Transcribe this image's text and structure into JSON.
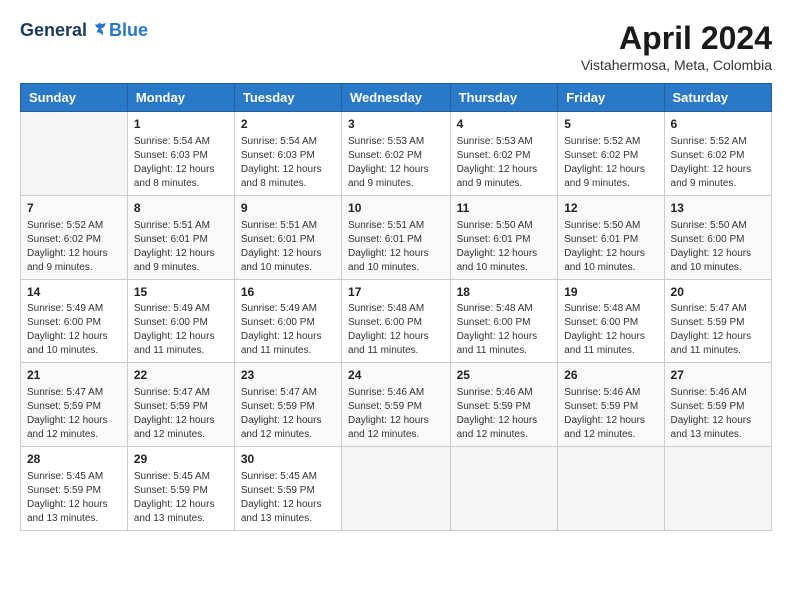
{
  "header": {
    "logo_general": "General",
    "logo_blue": "Blue",
    "month_title": "April 2024",
    "location": "Vistahermosa, Meta, Colombia"
  },
  "calendar": {
    "days_of_week": [
      "Sunday",
      "Monday",
      "Tuesday",
      "Wednesday",
      "Thursday",
      "Friday",
      "Saturday"
    ],
    "weeks": [
      [
        {
          "day": "",
          "sunrise": "",
          "sunset": "",
          "daylight": ""
        },
        {
          "day": "1",
          "sunrise": "Sunrise: 5:54 AM",
          "sunset": "Sunset: 6:03 PM",
          "daylight": "Daylight: 12 hours and 8 minutes."
        },
        {
          "day": "2",
          "sunrise": "Sunrise: 5:54 AM",
          "sunset": "Sunset: 6:03 PM",
          "daylight": "Daylight: 12 hours and 8 minutes."
        },
        {
          "day": "3",
          "sunrise": "Sunrise: 5:53 AM",
          "sunset": "Sunset: 6:02 PM",
          "daylight": "Daylight: 12 hours and 9 minutes."
        },
        {
          "day": "4",
          "sunrise": "Sunrise: 5:53 AM",
          "sunset": "Sunset: 6:02 PM",
          "daylight": "Daylight: 12 hours and 9 minutes."
        },
        {
          "day": "5",
          "sunrise": "Sunrise: 5:52 AM",
          "sunset": "Sunset: 6:02 PM",
          "daylight": "Daylight: 12 hours and 9 minutes."
        },
        {
          "day": "6",
          "sunrise": "Sunrise: 5:52 AM",
          "sunset": "Sunset: 6:02 PM",
          "daylight": "Daylight: 12 hours and 9 minutes."
        }
      ],
      [
        {
          "day": "7",
          "sunrise": "Sunrise: 5:52 AM",
          "sunset": "Sunset: 6:02 PM",
          "daylight": "Daylight: 12 hours and 9 minutes."
        },
        {
          "day": "8",
          "sunrise": "Sunrise: 5:51 AM",
          "sunset": "Sunset: 6:01 PM",
          "daylight": "Daylight: 12 hours and 9 minutes."
        },
        {
          "day": "9",
          "sunrise": "Sunrise: 5:51 AM",
          "sunset": "Sunset: 6:01 PM",
          "daylight": "Daylight: 12 hours and 10 minutes."
        },
        {
          "day": "10",
          "sunrise": "Sunrise: 5:51 AM",
          "sunset": "Sunset: 6:01 PM",
          "daylight": "Daylight: 12 hours and 10 minutes."
        },
        {
          "day": "11",
          "sunrise": "Sunrise: 5:50 AM",
          "sunset": "Sunset: 6:01 PM",
          "daylight": "Daylight: 12 hours and 10 minutes."
        },
        {
          "day": "12",
          "sunrise": "Sunrise: 5:50 AM",
          "sunset": "Sunset: 6:01 PM",
          "daylight": "Daylight: 12 hours and 10 minutes."
        },
        {
          "day": "13",
          "sunrise": "Sunrise: 5:50 AM",
          "sunset": "Sunset: 6:00 PM",
          "daylight": "Daylight: 12 hours and 10 minutes."
        }
      ],
      [
        {
          "day": "14",
          "sunrise": "Sunrise: 5:49 AM",
          "sunset": "Sunset: 6:00 PM",
          "daylight": "Daylight: 12 hours and 10 minutes."
        },
        {
          "day": "15",
          "sunrise": "Sunrise: 5:49 AM",
          "sunset": "Sunset: 6:00 PM",
          "daylight": "Daylight: 12 hours and 11 minutes."
        },
        {
          "day": "16",
          "sunrise": "Sunrise: 5:49 AM",
          "sunset": "Sunset: 6:00 PM",
          "daylight": "Daylight: 12 hours and 11 minutes."
        },
        {
          "day": "17",
          "sunrise": "Sunrise: 5:48 AM",
          "sunset": "Sunset: 6:00 PM",
          "daylight": "Daylight: 12 hours and 11 minutes."
        },
        {
          "day": "18",
          "sunrise": "Sunrise: 5:48 AM",
          "sunset": "Sunset: 6:00 PM",
          "daylight": "Daylight: 12 hours and 11 minutes."
        },
        {
          "day": "19",
          "sunrise": "Sunrise: 5:48 AM",
          "sunset": "Sunset: 6:00 PM",
          "daylight": "Daylight: 12 hours and 11 minutes."
        },
        {
          "day": "20",
          "sunrise": "Sunrise: 5:47 AM",
          "sunset": "Sunset: 5:59 PM",
          "daylight": "Daylight: 12 hours and 11 minutes."
        }
      ],
      [
        {
          "day": "21",
          "sunrise": "Sunrise: 5:47 AM",
          "sunset": "Sunset: 5:59 PM",
          "daylight": "Daylight: 12 hours and 12 minutes."
        },
        {
          "day": "22",
          "sunrise": "Sunrise: 5:47 AM",
          "sunset": "Sunset: 5:59 PM",
          "daylight": "Daylight: 12 hours and 12 minutes."
        },
        {
          "day": "23",
          "sunrise": "Sunrise: 5:47 AM",
          "sunset": "Sunset: 5:59 PM",
          "daylight": "Daylight: 12 hours and 12 minutes."
        },
        {
          "day": "24",
          "sunrise": "Sunrise: 5:46 AM",
          "sunset": "Sunset: 5:59 PM",
          "daylight": "Daylight: 12 hours and 12 minutes."
        },
        {
          "day": "25",
          "sunrise": "Sunrise: 5:46 AM",
          "sunset": "Sunset: 5:59 PM",
          "daylight": "Daylight: 12 hours and 12 minutes."
        },
        {
          "day": "26",
          "sunrise": "Sunrise: 5:46 AM",
          "sunset": "Sunset: 5:59 PM",
          "daylight": "Daylight: 12 hours and 12 minutes."
        },
        {
          "day": "27",
          "sunrise": "Sunrise: 5:46 AM",
          "sunset": "Sunset: 5:59 PM",
          "daylight": "Daylight: 12 hours and 13 minutes."
        }
      ],
      [
        {
          "day": "28",
          "sunrise": "Sunrise: 5:45 AM",
          "sunset": "Sunset: 5:59 PM",
          "daylight": "Daylight: 12 hours and 13 minutes."
        },
        {
          "day": "29",
          "sunrise": "Sunrise: 5:45 AM",
          "sunset": "Sunset: 5:59 PM",
          "daylight": "Daylight: 12 hours and 13 minutes."
        },
        {
          "day": "30",
          "sunrise": "Sunrise: 5:45 AM",
          "sunset": "Sunset: 5:59 PM",
          "daylight": "Daylight: 12 hours and 13 minutes."
        },
        {
          "day": "",
          "sunrise": "",
          "sunset": "",
          "daylight": ""
        },
        {
          "day": "",
          "sunrise": "",
          "sunset": "",
          "daylight": ""
        },
        {
          "day": "",
          "sunrise": "",
          "sunset": "",
          "daylight": ""
        },
        {
          "day": "",
          "sunrise": "",
          "sunset": "",
          "daylight": ""
        }
      ]
    ]
  }
}
